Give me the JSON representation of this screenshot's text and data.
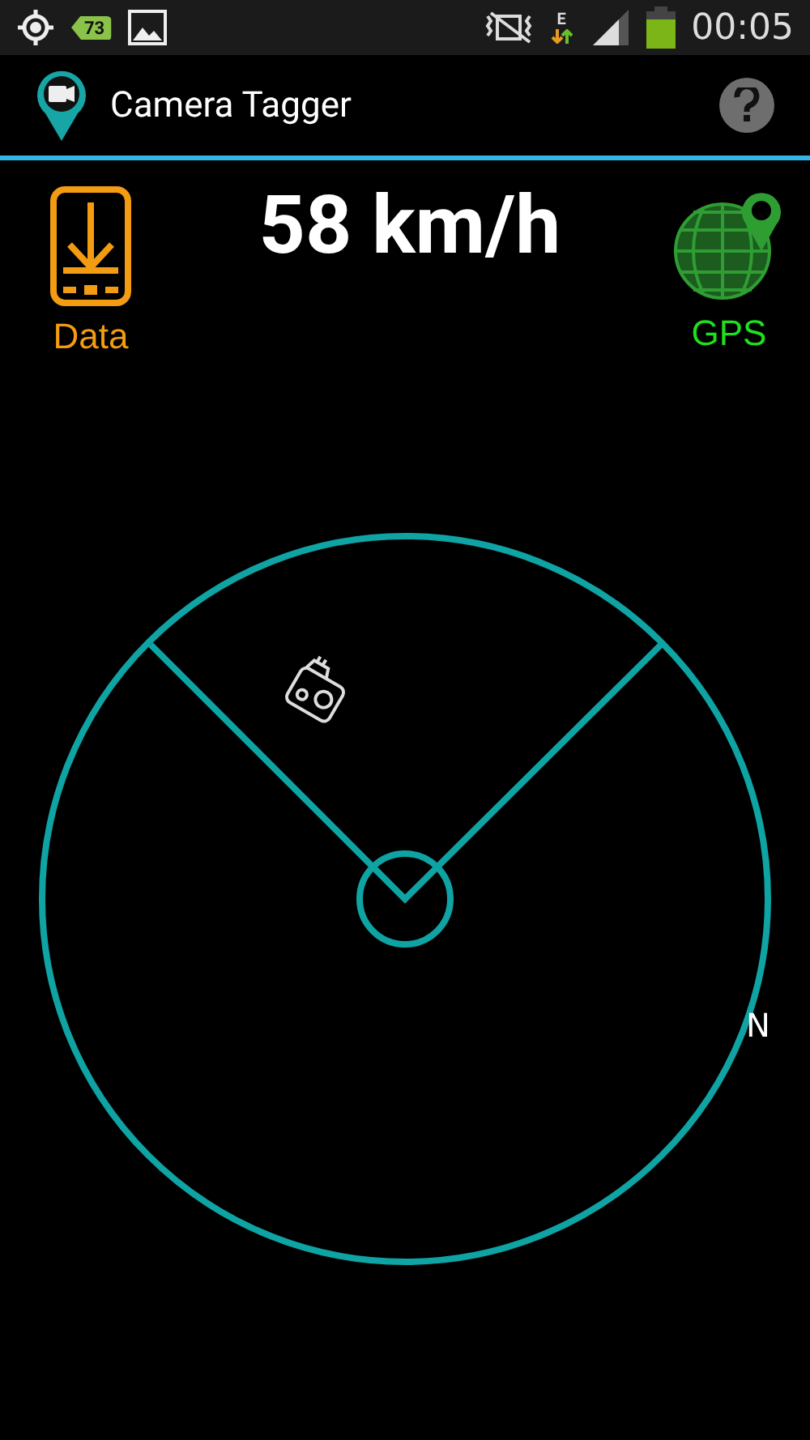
{
  "status_bar": {
    "notification_badge": "73",
    "network_type": "E",
    "time": "00:05"
  },
  "app_bar": {
    "title": "Camera Tagger"
  },
  "header": {
    "data_label": "Data",
    "speed": "58 km/h",
    "gps_label": "GPS"
  },
  "radar": {
    "heading_label": "N"
  }
}
